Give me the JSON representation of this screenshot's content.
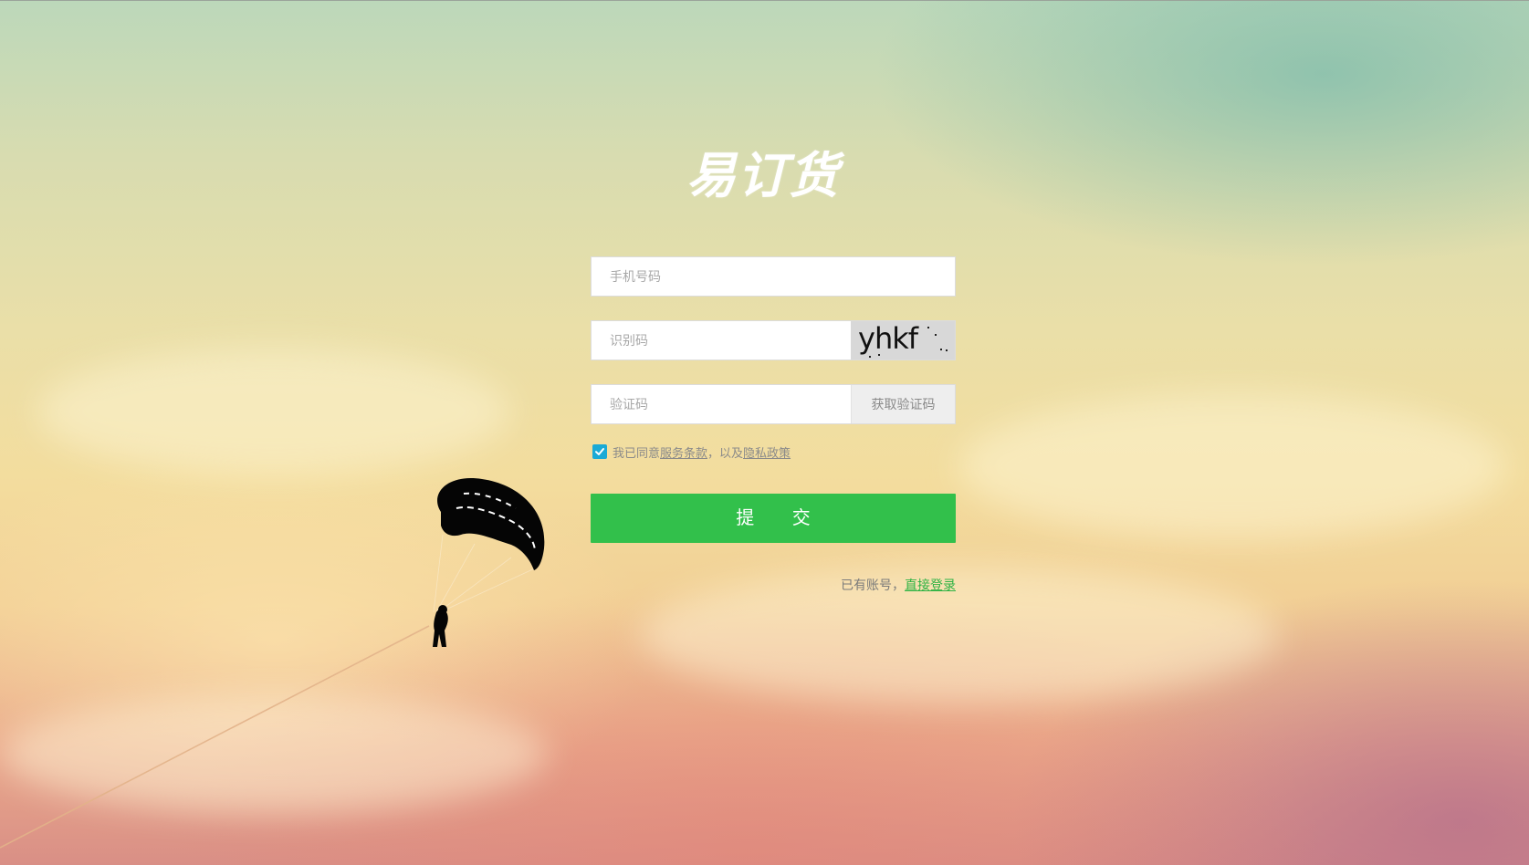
{
  "brand": {
    "logo_text": "易订货"
  },
  "form": {
    "phone": {
      "placeholder": "手机号码",
      "value": ""
    },
    "captcha": {
      "placeholder": "识别码",
      "value": "",
      "image_text": "yhkf"
    },
    "sms_code": {
      "placeholder": "验证码",
      "value": "",
      "button_label": "获取验证码"
    },
    "agreement": {
      "checked": true,
      "prefix": "我已同意",
      "terms_link": "服务条款",
      "middle": "，以及",
      "privacy_link": "隐私政策"
    },
    "submit_label": "提 交"
  },
  "footer": {
    "existing_account_text": "已有账号，",
    "login_link": "直接登录"
  },
  "colors": {
    "primary_green": "#32c04b",
    "checkbox_blue": "#1aaad6",
    "link_green": "#2fb344"
  },
  "icons": {
    "checkbox": "check-icon",
    "background_figure": "parachute-illustration"
  }
}
